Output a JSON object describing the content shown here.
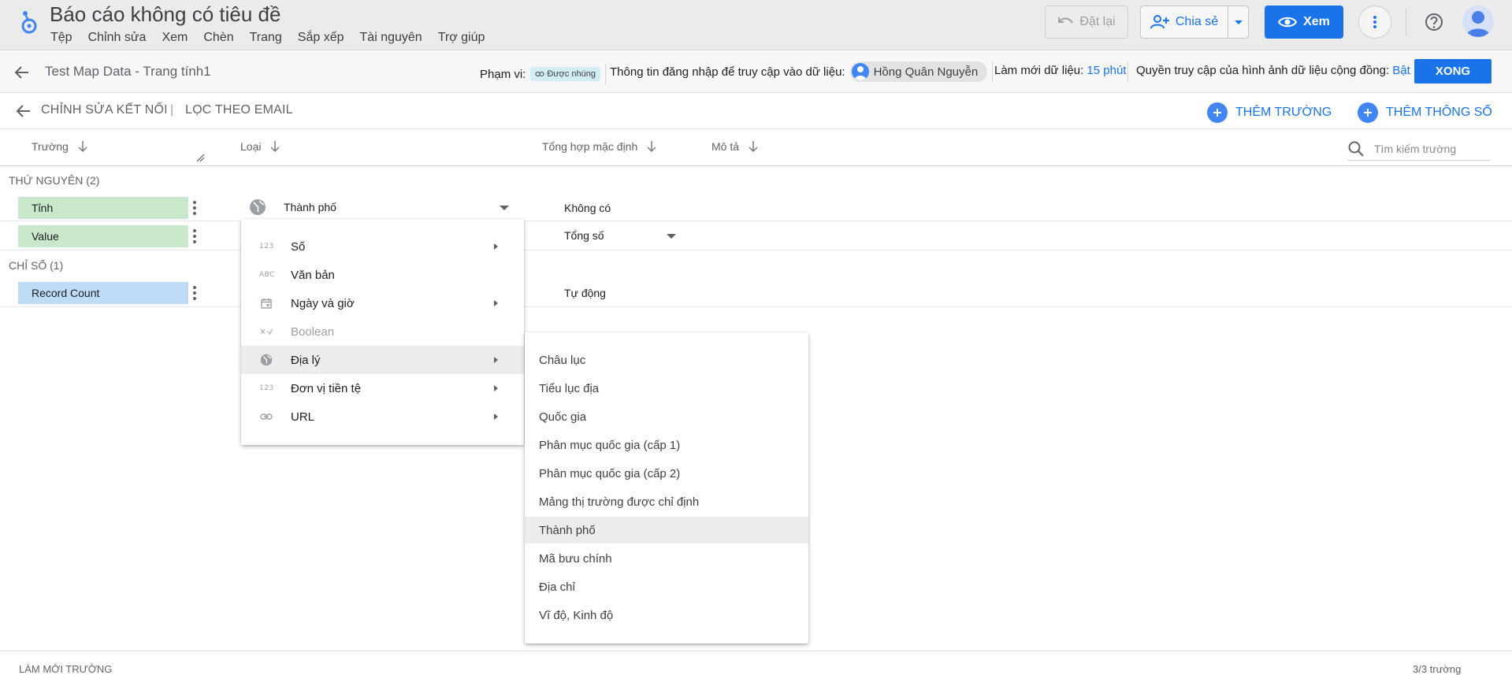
{
  "app": {
    "title": "Báo cáo không có tiêu đề",
    "menu": [
      "Tệp",
      "Chỉnh sửa",
      "Xem",
      "Chèn",
      "Trang",
      "Sắp xếp",
      "Tài nguyên",
      "Trợ giúp"
    ],
    "reset_label": "Đặt lại",
    "share_label": "Chia sẻ",
    "view_label": "Xem",
    "accent_color": "#1a73e8"
  },
  "datasource": {
    "name": "Test Map Data - Trang tính1",
    "scope_label": "Phạm vi:",
    "scope_chip": "Được nhúng",
    "credentials_label": "Thông tin đăng nhập để truy cập vào dữ liệu:",
    "credentials_user": "Hồng Quân Nguyễn",
    "refresh_label": "Làm mới dữ liệu:",
    "refresh_value": "15 phút",
    "public_label": "Quyền truy cập của hình ảnh dữ liệu cộng đồng:",
    "public_value": "Bật",
    "done_label": "XONG"
  },
  "editor": {
    "edit_connection": "CHỈNH SỬA KẾT NỐI",
    "separator": "|",
    "filter_by_email": "LỌC THEO EMAIL",
    "add_field": "THÊM TRƯỜNG",
    "add_parameter": "THÊM THÔNG SỐ",
    "columns": {
      "field": "Trường",
      "type": "Loại",
      "aggregation": "Tổng hợp mặc định",
      "description": "Mô tả"
    },
    "search_placeholder": "Tìm kiếm trường",
    "dimensions_title": "THỨ NGUYÊN (2)",
    "metrics_title": "CHỈ SỐ (1)",
    "rows": [
      {
        "name": "Tỉnh",
        "type": "Thành phố",
        "aggregation": "Không có"
      },
      {
        "name": "Value",
        "type": "",
        "aggregation": "Tổng số"
      },
      {
        "name": "Record Count",
        "type": "",
        "aggregation": "Tự động"
      }
    ],
    "bottom_left": "LÀM MỚI TRƯỜNG",
    "bottom_right": "3/3 trường"
  },
  "type_menu": {
    "items": [
      {
        "icon": "123",
        "label": "Số",
        "submenu": true,
        "disabled": false
      },
      {
        "icon": "ABC",
        "label": "Văn bản",
        "submenu": false,
        "disabled": false
      },
      {
        "icon": "calendar-icon",
        "label": "Ngày và giờ",
        "submenu": true,
        "disabled": false
      },
      {
        "icon": "boolean-icon",
        "label": "Boolean",
        "submenu": false,
        "disabled": true
      },
      {
        "icon": "globe-icon",
        "label": "Địa lý",
        "submenu": true,
        "disabled": false
      },
      {
        "icon": "123",
        "label": "Đơn vị tiền tệ",
        "submenu": true,
        "disabled": false
      },
      {
        "icon": "link-icon",
        "label": "URL",
        "submenu": true,
        "disabled": false
      }
    ],
    "highlighted": "Địa lý"
  },
  "geo_menu": {
    "items": [
      "Châu lục",
      "Tiểu lục địa",
      "Quốc gia",
      "Phân mục quốc gia (cấp 1)",
      "Phân mục quốc gia (cấp 2)",
      "Mảng thị trường được chỉ định",
      "Thành phố",
      "Mã bưu chính",
      "Địa chỉ",
      "Vĩ độ, Kinh độ"
    ],
    "highlighted": "Thành phố"
  }
}
